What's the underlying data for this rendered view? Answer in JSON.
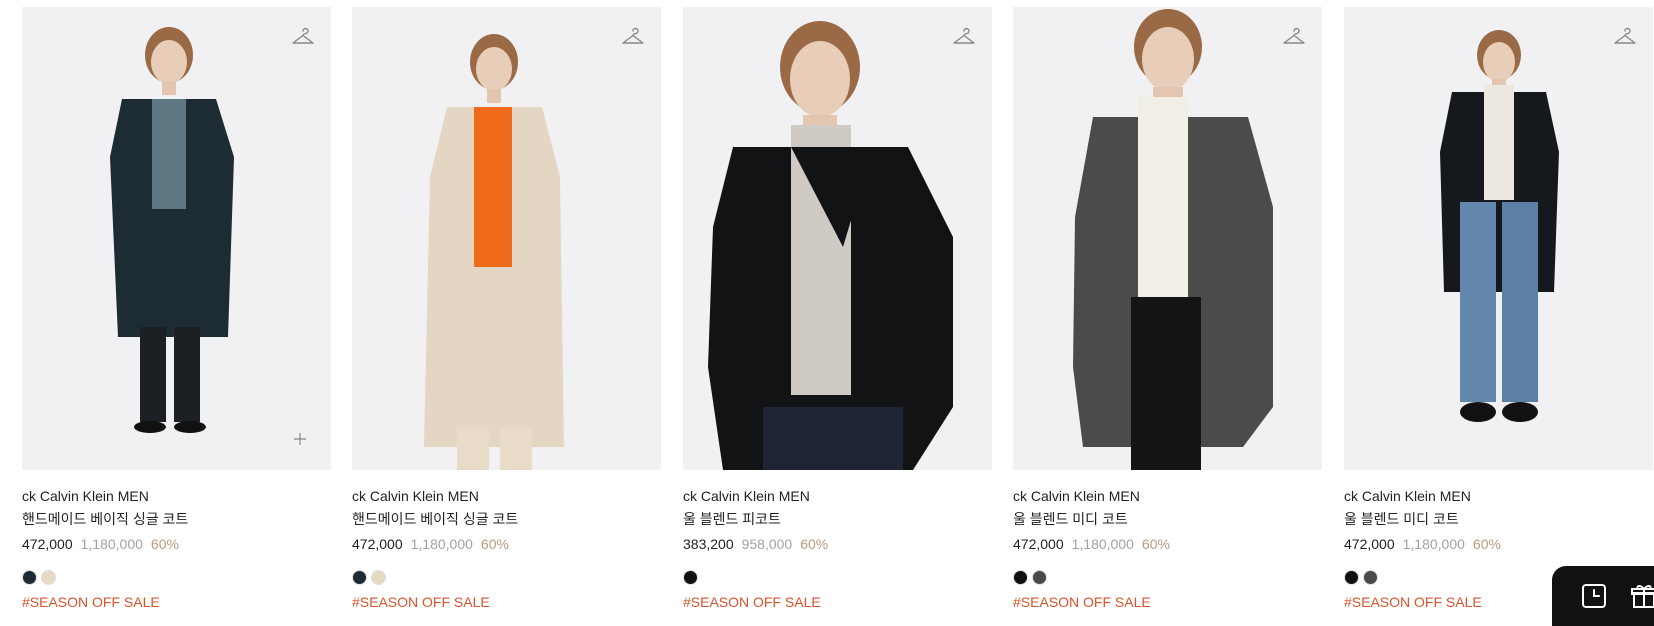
{
  "colors": {
    "swatch_navy": "#1e2a33",
    "swatch_beige": "#e6d9c2",
    "swatch_black": "#111111",
    "swatch_charcoal": "#4a4a4a",
    "sale_tag": "#d8542c",
    "discount": "#b59b80"
  },
  "products": [
    {
      "brand": "ck Calvin Klein MEN",
      "name": "핸드메이드 베이직 싱글 코트",
      "price": "472,000",
      "original_price": "1,180,000",
      "discount": "60%",
      "tag": "#SEASON OFF SALE",
      "icon": "hanger-icon",
      "swatches": [
        "#1e2a33",
        "#e6d9c2"
      ]
    },
    {
      "brand": "ck Calvin Klein MEN",
      "name": "핸드메이드 베이직 싱글 코트",
      "price": "472,000",
      "original_price": "1,180,000",
      "discount": "60%",
      "tag": "#SEASON OFF SALE",
      "icon": "hanger-icon",
      "swatches": [
        "#1e2a33",
        "#e6d9c2"
      ]
    },
    {
      "brand": "ck Calvin Klein MEN",
      "name": "울 블렌드 피코트",
      "price": "383,200",
      "original_price": "958,000",
      "discount": "60%",
      "tag": "#SEASON OFF SALE",
      "icon": "hanger-icon",
      "swatches": [
        "#111111"
      ]
    },
    {
      "brand": "ck Calvin Klein MEN",
      "name": "울 블렌드 미디 코트",
      "price": "472,000",
      "original_price": "1,180,000",
      "discount": "60%",
      "tag": "#SEASON OFF SALE",
      "icon": "hanger-icon",
      "swatches": [
        "#111111",
        "#4a4a4a"
      ]
    },
    {
      "brand": "ck Calvin Klein MEN",
      "name": "울 블렌드 미디 코트",
      "price": "472,000",
      "original_price": "1,180,000",
      "discount": "60%",
      "tag": "#SEASON OFF SALE",
      "icon": "hanger-icon",
      "swatches": [
        "#111111",
        "#4a4a4a"
      ]
    }
  ],
  "quick_add_icon": "plus-icon",
  "floating_bar": {
    "icons": [
      "recent-history-icon",
      "gift-icon"
    ]
  }
}
